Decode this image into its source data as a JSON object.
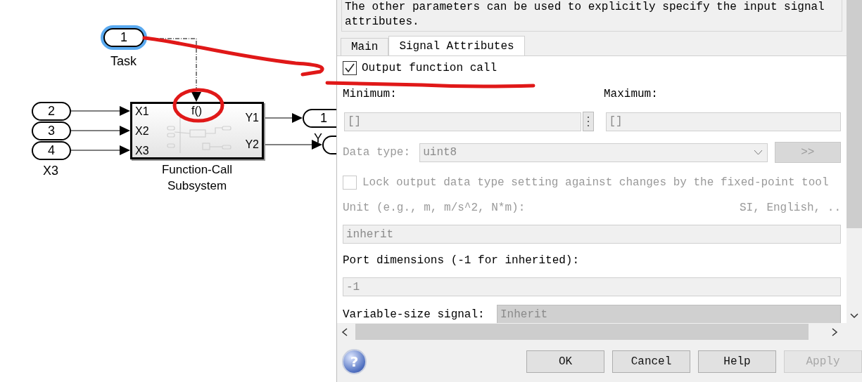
{
  "diagram": {
    "task_port": {
      "number": "1",
      "label": "Task",
      "selected": true
    },
    "inports": [
      {
        "number": "2"
      },
      {
        "number": "3"
      },
      {
        "number": "4",
        "label": "X3"
      }
    ],
    "subsystem": {
      "inputs": [
        "X1",
        "X2",
        "X3"
      ],
      "trigger": "f()",
      "outputs": [
        "Y1",
        "Y2"
      ],
      "title": [
        "Function-Call",
        "Subsystem"
      ]
    },
    "outports": [
      {
        "number": "1",
        "label": "Y"
      }
    ]
  },
  "dialog": {
    "description": [
      "The other parameters can be used to explicitly specify the input signal",
      "attributes."
    ],
    "tabs": [
      {
        "label": "Main",
        "selected": false
      },
      {
        "label": "Signal Attributes",
        "selected": true
      }
    ],
    "output_function_call": {
      "label": "Output function call",
      "checked": true
    },
    "minimum": {
      "label": "Minimum:",
      "value": "[]"
    },
    "maximum": {
      "label": "Maximum:",
      "value": "[]"
    },
    "data_type": {
      "label": "Data type:",
      "value": "uint8",
      "button": ">>",
      "disabled": true
    },
    "lock": {
      "label": "Lock output data type setting against changes by the fixed-point tool",
      "checked": false,
      "disabled": true
    },
    "unit": {
      "label": "Unit (e.g., m, m/s^2, N*m):",
      "link": "SI, English, ..",
      "value": "inherit",
      "disabled": true
    },
    "port_dimensions": {
      "label": "Port dimensions (-1 for inherited):",
      "value": "-1"
    },
    "variable_size": {
      "label": "Variable-size signal:",
      "value": "Inherit"
    },
    "help": "?",
    "buttons": [
      {
        "label": "OK",
        "disabled": false
      },
      {
        "label": "Cancel",
        "disabled": false
      },
      {
        "label": "Help",
        "disabled": false
      },
      {
        "label": "Apply",
        "disabled": true
      }
    ]
  }
}
